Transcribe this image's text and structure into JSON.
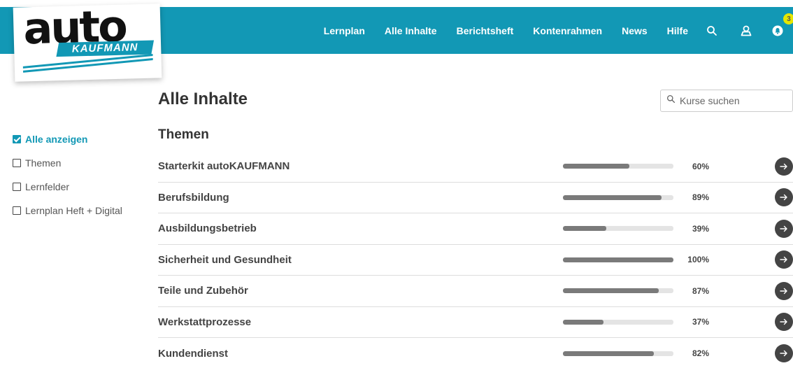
{
  "logo": {
    "word": "auto",
    "sub": "KAUFMANN"
  },
  "nav": {
    "items": [
      {
        "label": "Lernplan"
      },
      {
        "label": "Alle Inhalte"
      },
      {
        "label": "Berichtsheft"
      },
      {
        "label": "Kontenrahmen"
      },
      {
        "label": "News"
      },
      {
        "label": "Hilfe"
      }
    ],
    "icons": [
      "search-icon",
      "user-icon",
      "notification-icon"
    ],
    "notification_count": "3"
  },
  "page": {
    "title": "Alle Inhalte",
    "section": "Themen"
  },
  "search": {
    "placeholder": "Kurse suchen"
  },
  "sidebar": {
    "items": [
      {
        "label": "Alle anzeigen",
        "checked": true
      },
      {
        "label": "Themen",
        "checked": false
      },
      {
        "label": "Lernfelder",
        "checked": false
      },
      {
        "label": "Lernplan Heft + Digital",
        "checked": false
      }
    ]
  },
  "courses": [
    {
      "label": "Starterkit autoKAUFMANN",
      "progress": 60,
      "pct": "60%"
    },
    {
      "label": "Berufsbildung",
      "progress": 89,
      "pct": "89%"
    },
    {
      "label": "Ausbildungsbetrieb",
      "progress": 39,
      "pct": "39%"
    },
    {
      "label": "Sicherheit und Gesundheit",
      "progress": 100,
      "pct": "100%"
    },
    {
      "label": "Teile und Zubehör",
      "progress": 87,
      "pct": "87%"
    },
    {
      "label": "Werkstattprozesse",
      "progress": 37,
      "pct": "37%"
    },
    {
      "label": "Kundendienst",
      "progress": 82,
      "pct": "82%"
    }
  ],
  "colors": {
    "brand": "#1298b5",
    "badge": "#e6e600",
    "progress_fill": "#7a7a7a",
    "arrow_bg": "#444444"
  }
}
